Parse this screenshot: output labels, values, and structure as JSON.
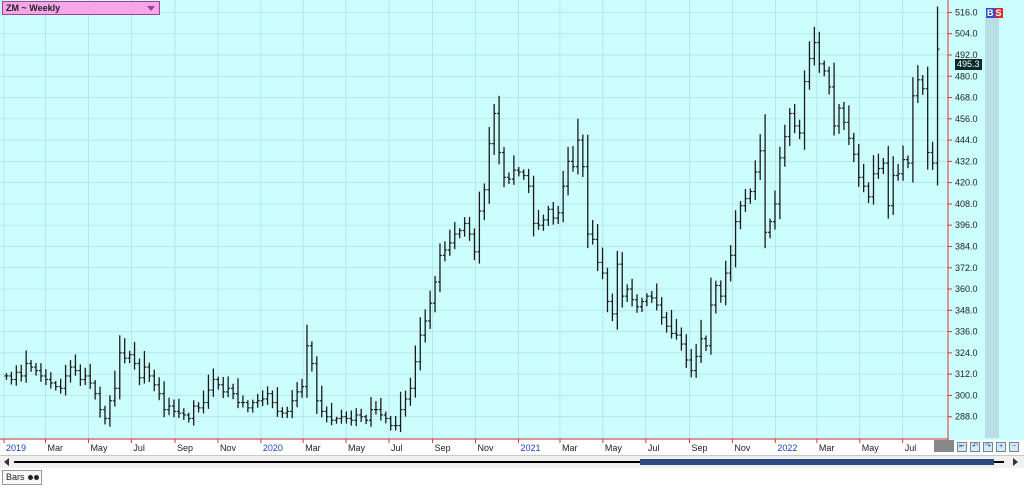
{
  "header": {
    "symbol_label": "ZM ~ Weekly"
  },
  "badges": {
    "b": "B",
    "s": "S"
  },
  "price_tag": "495.3",
  "footer": {
    "tab_label": "Bars"
  },
  "colors": {
    "background": "#ccfefe",
    "grid": "#a8e0e8",
    "bar": "#1a1a1a",
    "axis_line": "#e03030",
    "right_strip": "#b8dde4"
  },
  "chart_data": {
    "type": "ohlc",
    "title": "ZM ~ Weekly",
    "xlabel": "",
    "ylabel": "",
    "ylim": [
      276,
      523
    ],
    "grid": true,
    "legend": "none",
    "y_ticks": [
      288.0,
      300.0,
      312.0,
      324.0,
      336.0,
      348.0,
      360.0,
      372.0,
      384.0,
      396.0,
      408.0,
      420.0,
      432.0,
      444.0,
      456.0,
      468.0,
      480.0,
      492.0,
      504.0,
      516.0
    ],
    "y_tick_labels": [
      "288.0",
      "300.0",
      "312.0",
      "324.0",
      "336.0",
      "348.0",
      "360.0",
      "372.0",
      "384.0",
      "396.0",
      "408.0",
      "420.0",
      "432.0",
      "444.0",
      "456.0",
      "468.0",
      "480.0",
      "492.0",
      "504.0",
      "516.0"
    ],
    "x_tick_labels": [
      {
        "date": "2019-01",
        "label": "2019",
        "year": true
      },
      {
        "date": "2019-03",
        "label": "Mar",
        "year": false
      },
      {
        "date": "2019-05",
        "label": "May",
        "year": false
      },
      {
        "date": "2019-07",
        "label": "Jul",
        "year": false
      },
      {
        "date": "2019-09",
        "label": "Sep",
        "year": false
      },
      {
        "date": "2019-11",
        "label": "Nov",
        "year": false
      },
      {
        "date": "2020-01",
        "label": "2020",
        "year": true
      },
      {
        "date": "2020-03",
        "label": "Mar",
        "year": false
      },
      {
        "date": "2020-05",
        "label": "May",
        "year": false
      },
      {
        "date": "2020-07",
        "label": "Jul",
        "year": false
      },
      {
        "date": "2020-09",
        "label": "Sep",
        "year": false
      },
      {
        "date": "2020-11",
        "label": "Nov",
        "year": false
      },
      {
        "date": "2021-01",
        "label": "2021",
        "year": true
      },
      {
        "date": "2021-03",
        "label": "Mar",
        "year": false
      },
      {
        "date": "2021-05",
        "label": "May",
        "year": false
      },
      {
        "date": "2021-07",
        "label": "Jul",
        "year": false
      },
      {
        "date": "2021-09",
        "label": "Sep",
        "year": false
      },
      {
        "date": "2021-11",
        "label": "Nov",
        "year": false
      },
      {
        "date": "2022-01",
        "label": "2022",
        "year": true
      },
      {
        "date": "2022-03",
        "label": "Mar",
        "year": false
      },
      {
        "date": "2022-05",
        "label": "May",
        "year": false
      },
      {
        "date": "2022-07",
        "label": "Jul",
        "year": false
      }
    ],
    "last_value": 495.3,
    "closes": [
      311.0,
      309.0,
      313.0,
      311.0,
      318.0,
      316.0,
      314.0,
      311.0,
      309.0,
      307.0,
      305.0,
      304.0,
      311.0,
      316.0,
      314.0,
      309.0,
      311.0,
      307.0,
      301.0,
      292.0,
      287.0,
      297.0,
      304.0,
      324.0,
      321.0,
      323.0,
      318.0,
      310.0,
      316.0,
      311.0,
      306.0,
      301.0,
      292.0,
      294.0,
      291.0,
      290.0,
      289.0,
      287.0,
      294.0,
      293.0,
      296.0,
      303.0,
      309.0,
      306.0,
      302.0,
      304.0,
      301.0,
      296.0,
      296.0,
      293.0,
      296.0,
      297.0,
      298.0,
      301.0,
      296.0,
      291.0,
      290.0,
      291.0,
      297.0,
      302.0,
      305.0,
      328.0,
      318.0,
      297.0,
      291.0,
      288.0,
      286.0,
      287.0,
      288.0,
      287.0,
      286.0,
      289.0,
      288.0,
      286.0,
      292.0,
      292.0,
      289.0,
      287.0,
      283.0,
      283.0,
      292.0,
      298.0,
      304.0,
      319.0,
      334.0,
      342.0,
      352.0,
      364.0,
      379.0,
      382.0,
      386.0,
      391.0,
      393.0,
      397.0,
      391.0,
      381.0,
      404.0,
      416.0,
      442.0,
      459.0,
      437.0,
      423.0,
      422.0,
      427.0,
      426.0,
      424.0,
      418.0,
      397.0,
      396.0,
      399.0,
      405.0,
      400.0,
      403.0,
      418.0,
      432.0,
      429.0,
      444.0,
      429.0,
      391.0,
      388.0,
      375.0,
      369.0,
      353.0,
      346.0,
      374.0,
      356.0,
      360.0,
      354.0,
      350.0,
      353.0,
      356.0,
      355.0,
      351.0,
      344.0,
      339.0,
      335.0,
      334.0,
      329.0,
      320.0,
      314.0,
      322.0,
      332.0,
      328.0,
      351.0,
      362.0,
      356.0,
      369.0,
      379.0,
      398.0,
      407.0,
      411.0,
      415.0,
      426.0,
      438.0,
      392.0,
      398.0,
      408.0,
      434.0,
      446.0,
      459.0,
      452.0,
      448.0,
      477.0,
      490.0,
      499.0,
      487.0,
      483.0,
      474.0,
      452.0,
      462.0,
      454.0,
      445.0,
      436.0,
      423.0,
      418.0,
      412.0,
      425.0,
      428.0,
      431.0,
      407.0,
      424.0,
      425.0,
      433.0,
      431.0,
      469.0,
      478.0,
      473.0,
      437.0,
      431.0,
      495.3
    ]
  }
}
